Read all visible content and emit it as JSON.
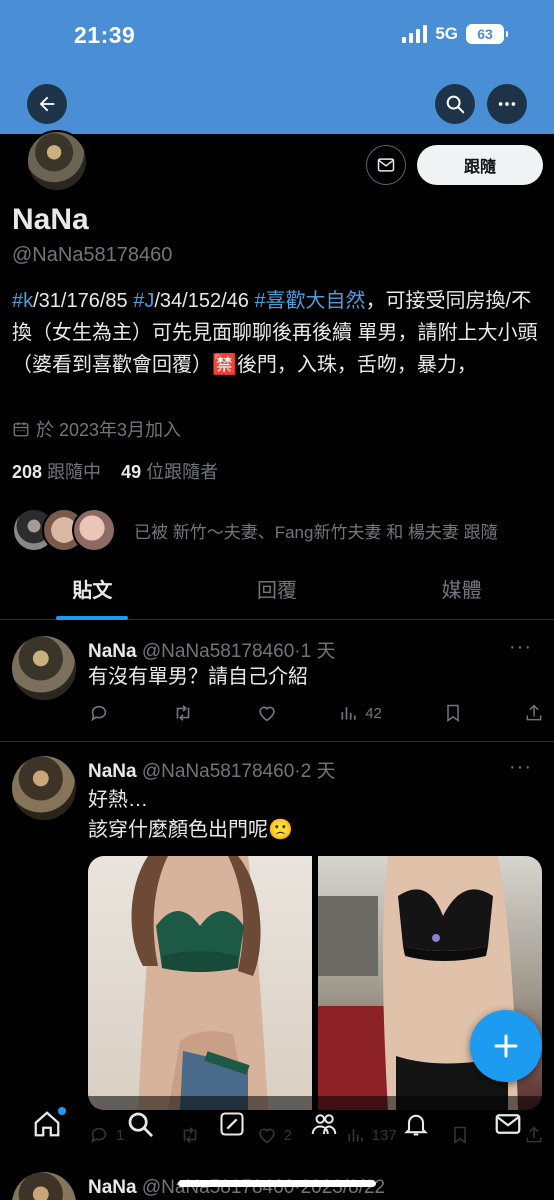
{
  "status": {
    "time": "21:39",
    "network": "5G",
    "battery": "63"
  },
  "header": {
    "back_icon": "back-arrow-icon",
    "search_icon": "search-icon",
    "more_icon": "more-icon"
  },
  "profile": {
    "name": "NaNa",
    "handle": "@NaNa58178460",
    "follow_label": "跟隨",
    "bio_parts": [
      {
        "t": "#k",
        "tag": true
      },
      {
        "t": "/31/176/85 ",
        "tag": false
      },
      {
        "t": "#J",
        "tag": true
      },
      {
        "t": "/34/152/46 ",
        "tag": false
      },
      {
        "t": "#喜歡大自然",
        "tag": true
      },
      {
        "t": "，可接受同房換/不換（女生為主）可先見面聊聊後再後續 單男，請附上大小頭（婆看到喜歡會回覆）🈲後門，入珠，舌吻，暴力，",
        "tag": false
      }
    ],
    "joined": "於 2023年3月加入",
    "following_count": "208",
    "following_label": "跟隨中",
    "followers_count": "49",
    "followers_label": "位跟隨者",
    "followed_by": "已被 新竹～夫妻、Fang新竹夫妻 和 楊夫妻 跟隨"
  },
  "tabs": [
    {
      "label": "貼文",
      "active": true
    },
    {
      "label": "回覆",
      "active": false
    },
    {
      "label": "媒體",
      "active": false
    }
  ],
  "tweets": [
    {
      "name": "NaNa",
      "handle": "@NaNa58178460",
      "sep": "·",
      "time": "1 天",
      "lines": [
        "有沒有單男？請自己介紹"
      ],
      "reply_count": "",
      "retweet_count": "",
      "like_count": "",
      "views": "42"
    },
    {
      "name": "NaNa",
      "handle": "@NaNa58178460",
      "sep": "·",
      "time": "2 天",
      "lines": [
        "好熱…",
        "該穿什麼顏色出門呢🙁"
      ],
      "reply_count": "1",
      "retweet_count": "",
      "like_count": "2",
      "views": "137"
    }
  ],
  "peek": {
    "name": "NaNa",
    "handle": "@NaNa58178460",
    "sep": "·",
    "time": "2023/8/22"
  },
  "colors": {
    "accent": "#1d9bf0",
    "banner": "#4a8ed6",
    "muted": "#71767b"
  }
}
